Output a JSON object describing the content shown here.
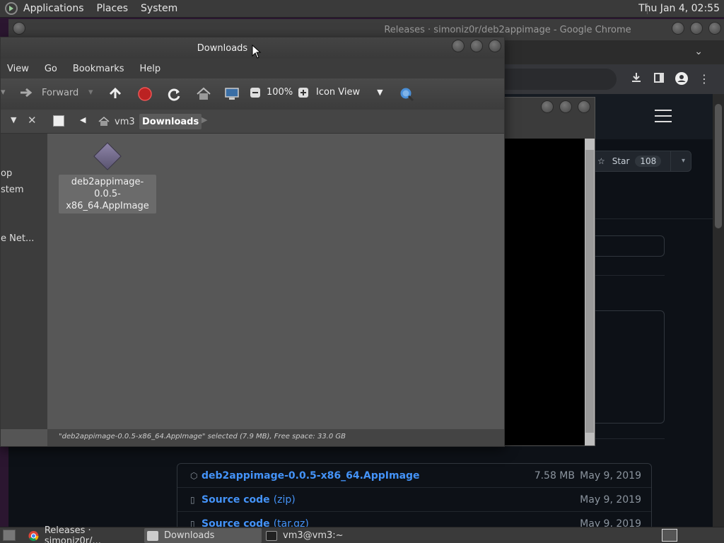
{
  "top_panel": {
    "menus": [
      "Applications",
      "Places",
      "System"
    ],
    "clock": "Thu Jan  4, 02:55"
  },
  "chrome": {
    "title": "Releases · simoniz0r/deb2appimage - Google Chrome",
    "star_label": "Star",
    "star_count": "108",
    "assets": [
      {
        "name": "deb2appimage-0.0.5-x86_64.AppImage",
        "ext": "",
        "size": "7.58 MB",
        "date": "May 9, 2019"
      },
      {
        "name": "Source code",
        "ext": "(zip)",
        "size": "",
        "date": "May 9, 2019"
      },
      {
        "name": "Source code",
        "ext": "(tar.gz)",
        "size": "",
        "date": "May 9, 2019"
      }
    ]
  },
  "file_manager": {
    "title": "Downloads",
    "menus": [
      "View",
      "Go",
      "Bookmarks",
      "Help"
    ],
    "toolbar": {
      "forward": "Forward",
      "zoom": "100%",
      "view_mode": "Icon View"
    },
    "path": [
      "vm3",
      "Downloads"
    ],
    "sidebar": [
      "op",
      "stem",
      "e Net..."
    ],
    "file_line1": "deb2appimage-0.0.5-",
    "file_line2": "x86_64.AppImage",
    "status": "\"deb2appimage-0.0.5-x86_64.AppImage\" selected (7.9 MB), Free space: 33.0 GB"
  },
  "taskbar": {
    "items": [
      "Releases · simoniz0r/...",
      "Downloads",
      "vm3@vm3:~"
    ]
  },
  "colors": {
    "gh_bg": "#0d1117",
    "link": "#4493f8",
    "stop_red": "#c0392b"
  }
}
